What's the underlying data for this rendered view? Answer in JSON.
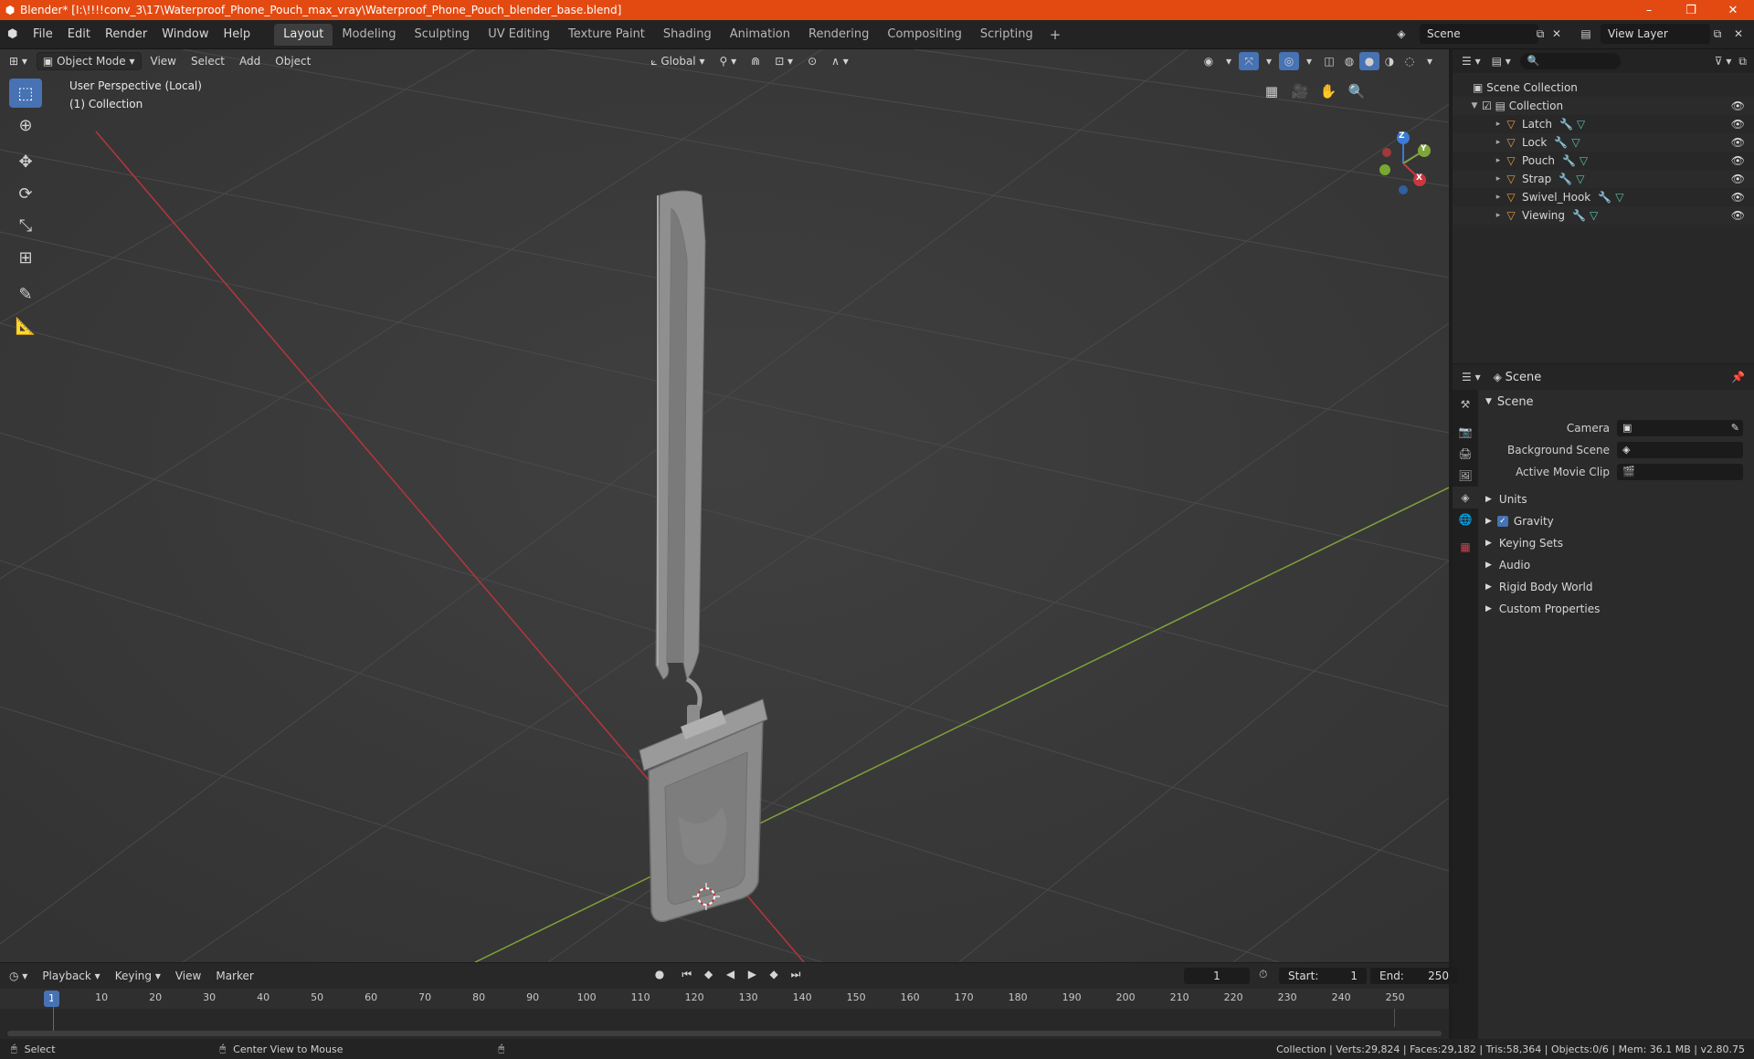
{
  "titlebar": {
    "title": "Blender* [I:\\!!!!conv_3\\17\\Waterproof_Phone_Pouch_max_vray\\Waterproof_Phone_Pouch_blender_base.blend]",
    "minimize": "–",
    "restore": "❐",
    "close": "✕"
  },
  "menu": [
    "File",
    "Edit",
    "Render",
    "Window",
    "Help"
  ],
  "workspaces": [
    "Layout",
    "Modeling",
    "Sculpting",
    "UV Editing",
    "Texture Paint",
    "Shading",
    "Animation",
    "Rendering",
    "Compositing",
    "Scripting"
  ],
  "workspace_add": "+",
  "scene_name": "Scene",
  "view_layer": "View Layer",
  "viewport": {
    "mode": "Object Mode",
    "menus": [
      "View",
      "Select",
      "Add",
      "Object"
    ],
    "orientation": "Global",
    "perspective_label": "User Perspective (Local)",
    "collection_label": "(1) Collection",
    "gizmo": {
      "z": "Z",
      "y": "Y",
      "x": "X"
    }
  },
  "outliner": {
    "root": "Scene Collection",
    "collection": "Collection",
    "objects": [
      "Latch",
      "Lock",
      "Pouch",
      "Strap",
      "Swivel_Hook",
      "Viewing"
    ]
  },
  "properties": {
    "header": "Scene",
    "section": "Scene",
    "fields": [
      {
        "label": "Camera",
        "value": ""
      },
      {
        "label": "Background Scene",
        "value": ""
      },
      {
        "label": "Active Movie Clip",
        "value": ""
      }
    ],
    "subpanels": [
      "Units",
      "Gravity",
      "Keying Sets",
      "Audio",
      "Rigid Body World",
      "Custom Properties"
    ]
  },
  "timeline": {
    "menus": [
      "Playback",
      "Keying",
      "View",
      "Marker"
    ],
    "current_frame": "1",
    "start_label": "Start:",
    "start": "1",
    "end_label": "End:",
    "end": "250",
    "ticks": [
      "10",
      "20",
      "30",
      "40",
      "50",
      "60",
      "70",
      "80",
      "90",
      "100",
      "110",
      "120",
      "130",
      "140",
      "150",
      "160",
      "170",
      "180",
      "190",
      "200",
      "210",
      "220",
      "230",
      "240",
      "250"
    ]
  },
  "statusbar": {
    "left": "Select",
    "middle": "Center View to Mouse",
    "right": "Collection | Verts:29,824 | Faces:29,182 | Tris:58,364 | Objects:0/6 | Mem: 36.1 MB | v2.80.75"
  },
  "colors": {
    "titlebar": "#e34a12",
    "accent": "#4772b3",
    "x_axis": "#c9383f",
    "y_axis": "#7ea53a",
    "z_axis": "#3b7bd4"
  }
}
